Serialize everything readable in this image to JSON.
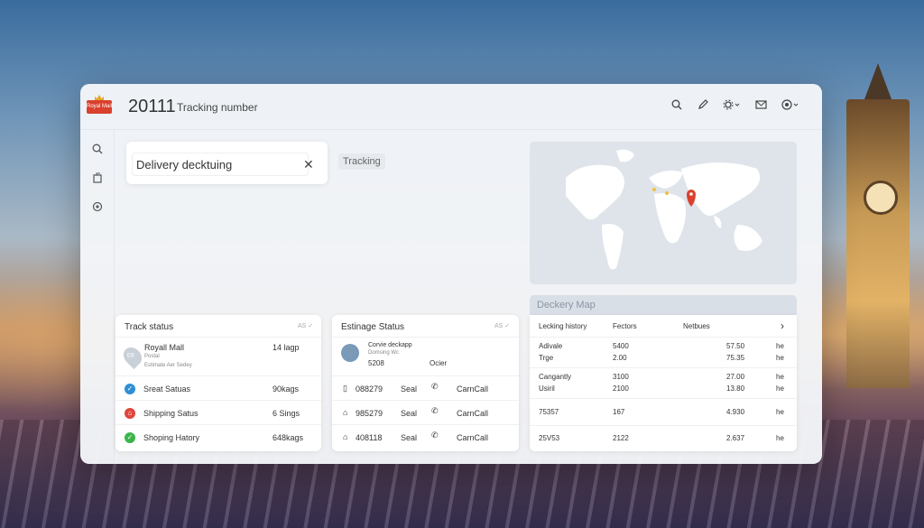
{
  "app": {
    "logo_text": "Royal Mail",
    "tracking_number": "20111",
    "tracking_label": "Tracking number"
  },
  "topbar_icons": [
    "search-icon",
    "edit-icon",
    "settings-icon",
    "mail-icon",
    "account-icon"
  ],
  "sidebar_icons": [
    "search-icon",
    "package-icon",
    "location-icon"
  ],
  "search": {
    "value": "Delivery decktuing",
    "clear_symbol": "✕"
  },
  "tracking_chip": "Tracking",
  "map": {
    "tab_label": "Deckery Map",
    "marker_color": "#d9412e"
  },
  "track_status": {
    "title": "Track status",
    "tag": "AS ✓",
    "carrier": {
      "pin_text": "EB",
      "name": "Royall Mall",
      "sub1": "Postal",
      "sub2": "Estimate Aer Sedey",
      "value": "14 lagp"
    },
    "rows": [
      {
        "icon": "✓",
        "color": "#2e8fd6",
        "label": "Sreat Satuas",
        "value": "90kags"
      },
      {
        "icon": "⌂",
        "color": "#e0453b",
        "label": "Shipping Satus",
        "value": "6 Sings"
      },
      {
        "icon": "✓",
        "color": "#3bb54a",
        "label": "Shoping Hatory",
        "value": "648kags"
      }
    ]
  },
  "estimate_status": {
    "title": "Estinage Status",
    "tag": "AS ✓",
    "carrier": {
      "name": "Corvie deckapp",
      "sub": "Domsing Wc",
      "code": "5208",
      "label": "Ocier"
    },
    "rows": [
      {
        "icon": "▯",
        "id": "088279",
        "type": "Seal",
        "action": "CarnCall"
      },
      {
        "icon": "⌂",
        "id": "985279",
        "type": "Seal",
        "action": "CarnCall"
      },
      {
        "icon": "⌂",
        "id": "408118",
        "type": "Seal",
        "action": "CarnCall"
      }
    ]
  },
  "history": {
    "headers": [
      "Lecking history",
      "Fectors",
      "Netbues",
      "›"
    ],
    "rows": [
      {
        "a": "Adivale",
        "b": "5400",
        "c": "57.50",
        "d": "he"
      },
      {
        "a": "Trge",
        "b": "2.00",
        "c": "75.35",
        "d": "he"
      },
      {
        "a": "Cangantly",
        "b": "3100",
        "c": "27.00",
        "d": "he"
      },
      {
        "a": "Usiril",
        "b": "2100",
        "c": "13.80",
        "d": "he"
      },
      {
        "a": "75357",
        "b": "167",
        "c": "4.930",
        "d": "he"
      },
      {
        "a": "25V53",
        "b": "2122",
        "c": "2.637",
        "d": "he"
      }
    ]
  }
}
